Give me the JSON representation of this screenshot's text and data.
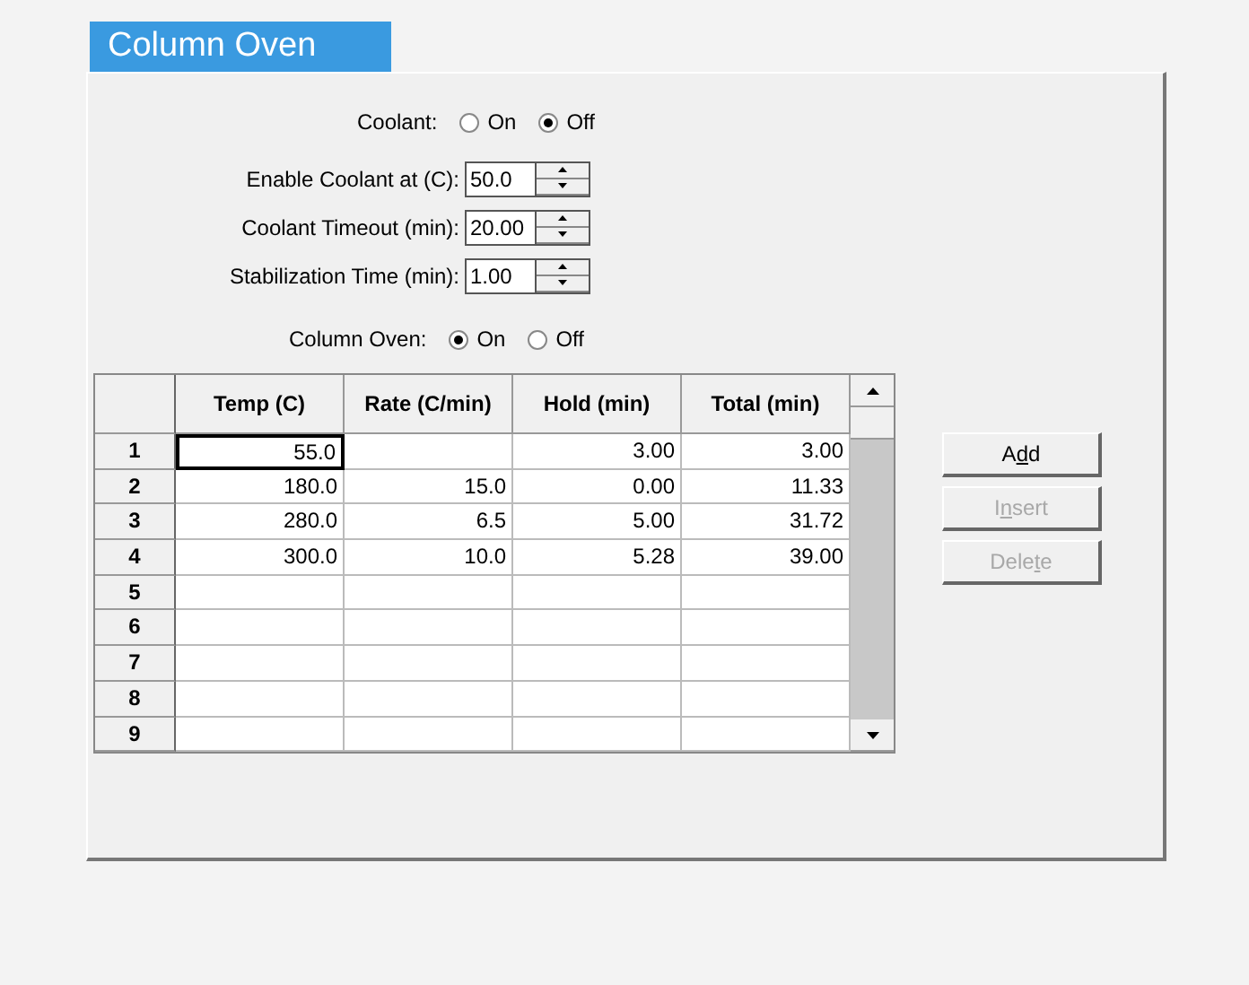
{
  "tab": {
    "title": "Column Oven",
    "selected": true
  },
  "coolant": {
    "label": "Coolant:",
    "options": [
      {
        "label": "On",
        "selected": false
      },
      {
        "label": "Off",
        "selected": true
      }
    ]
  },
  "fields": [
    {
      "label": "Enable Coolant at (C):",
      "value": "50.0"
    },
    {
      "label": "Coolant Timeout (min):",
      "value": "20.00"
    },
    {
      "label": "Stabilization Time (min):",
      "value": "1.00"
    }
  ],
  "column_oven": {
    "label": "Column Oven:",
    "options": [
      {
        "label": "On",
        "selected": true
      },
      {
        "label": "Off",
        "selected": false
      }
    ]
  },
  "grid": {
    "columns": [
      "Temp (C)",
      "Rate (C/min)",
      "Hold (min)",
      "Total (min)"
    ],
    "rows": [
      {
        "header": "1",
        "cells": [
          {
            "text": "55.0",
            "focused": true
          },
          {
            "focused": false
          },
          {
            "text": "3.00",
            "focused": false
          },
          {
            "text": "3.00",
            "focused": false
          }
        ]
      },
      {
        "header": "2",
        "cells": [
          {
            "text": "180.0",
            "focused": false
          },
          {
            "text": "15.0",
            "focused": false
          },
          {
            "text": "0.00",
            "focused": false
          },
          {
            "text": "11.33",
            "focused": false
          }
        ]
      },
      {
        "header": "3",
        "cells": [
          {
            "text": "280.0",
            "focused": false
          },
          {
            "text": "6.5",
            "focused": false
          },
          {
            "text": "5.00",
            "focused": false
          },
          {
            "text": "31.72",
            "focused": false
          }
        ]
      },
      {
        "header": "4",
        "cells": [
          {
            "text": "300.0",
            "focused": false
          },
          {
            "text": "10.0",
            "focused": false
          },
          {
            "text": "5.28",
            "focused": false
          },
          {
            "text": "39.00",
            "focused": false
          }
        ]
      },
      {
        "header": "5",
        "cells": [
          {
            "focused": false
          },
          {
            "focused": false
          },
          {
            "focused": false
          },
          {
            "focused": false
          }
        ]
      },
      {
        "header": "6",
        "cells": [
          {
            "focused": false
          },
          {
            "focused": false
          },
          {
            "focused": false
          },
          {
            "focused": false
          }
        ]
      },
      {
        "header": "7",
        "cells": [
          {
            "focused": false
          },
          {
            "focused": false
          },
          {
            "focused": false
          },
          {
            "focused": false
          }
        ]
      },
      {
        "header": "8",
        "cells": [
          {
            "focused": false
          },
          {
            "focused": false
          },
          {
            "focused": false
          },
          {
            "focused": false
          }
        ]
      },
      {
        "header": "9",
        "cells": [
          {
            "focused": false
          },
          {
            "focused": false
          },
          {
            "focused": false
          },
          {
            "focused": false
          }
        ]
      }
    ]
  },
  "buttons": [
    {
      "label_before": "A",
      "underlined": "d",
      "label_after": "d",
      "disabled": false
    },
    {
      "label_before": "I",
      "underlined": "n",
      "label_after": "sert",
      "disabled": true
    },
    {
      "label_before": "Dele",
      "underlined": "t",
      "label_after": "e",
      "disabled": true
    }
  ]
}
